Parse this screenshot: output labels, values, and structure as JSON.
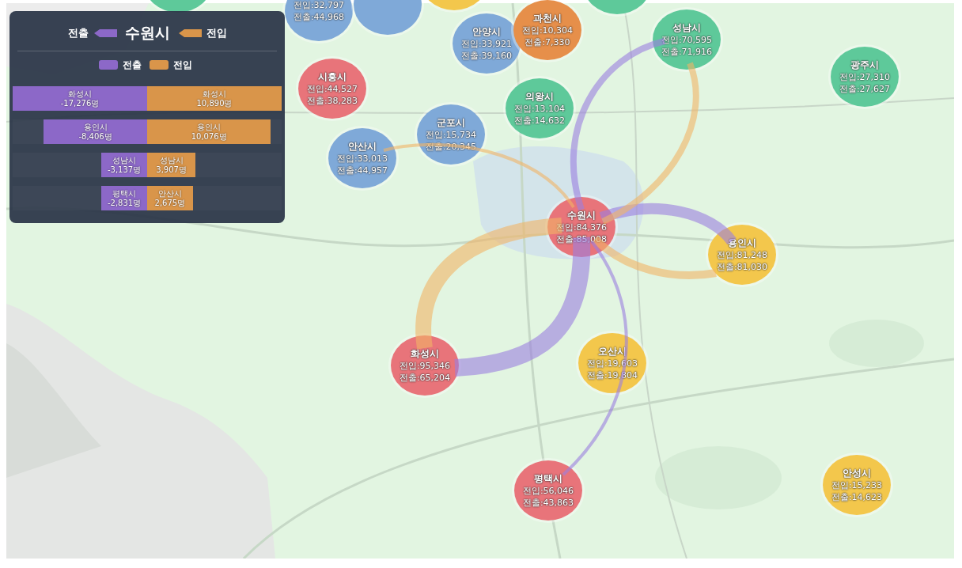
{
  "panel": {
    "out_label": "전출",
    "city": "수원시",
    "in_label": "전입",
    "legend": [
      {
        "label": "전출",
        "color": "#8c68c8"
      },
      {
        "label": "전입",
        "color": "#d9954a"
      }
    ],
    "rows": [
      {
        "outflow": {
          "city": "화성시",
          "value": "-17,276명",
          "level": 1
        },
        "inflow": {
          "city": "화성시",
          "value": "10,890명",
          "level": 1
        }
      },
      {
        "outflow": {
          "city": "용인시",
          "value": "-8,406명",
          "level": 0.77
        },
        "inflow": {
          "city": "용인시",
          "value": "10,076명",
          "level": 0.92
        }
      },
      {
        "outflow": {
          "city": "성남시",
          "value": "-3,137명",
          "level": 0.34
        },
        "inflow": {
          "city": "성남시",
          "value": "3,907명",
          "level": 0.36
        }
      },
      {
        "outflow": {
          "city": "평택시",
          "value": "-2,831명",
          "level": 0.34
        },
        "inflow": {
          "city": "안산시",
          "value": "2,675명",
          "level": 0.34
        }
      }
    ]
  },
  "bubbles": [
    {
      "color": "#5ec99a"
    },
    {
      "color": "#7fa9d8",
      "lines": [
        "전입:32,797",
        "전출:44,968"
      ]
    },
    {
      "color": "#7fa9d8"
    },
    {
      "color": "#f3c74c"
    },
    {
      "color": "#5ec99a"
    },
    {
      "name": "안양시",
      "color": "#7fa9d8",
      "lines": [
        "전입:33,921",
        "전출:39,160"
      ]
    },
    {
      "name": "과천시",
      "color": "#e68f4a",
      "lines": [
        "전입:10,304",
        "전출:7,330"
      ]
    },
    {
      "name": "성남시",
      "color": "#5ec99a",
      "lines": [
        "전입:70,595",
        "전출:71,916"
      ]
    },
    {
      "name": "광주시",
      "color": "#5ec99a",
      "lines": [
        "전입:27,310",
        "전출:27,627"
      ]
    },
    {
      "name": "시흥시",
      "color": "#e8747a",
      "lines": [
        "전입:44,527",
        "전출:38,283"
      ]
    },
    {
      "name": "의왕시",
      "color": "#5ec99a",
      "lines": [
        "전입:13,104",
        "전출:14,632"
      ]
    },
    {
      "name": "군포시",
      "color": "#7fa9d8",
      "lines": [
        "전입:15,734",
        "전출:20,345"
      ]
    },
    {
      "name": "안산시",
      "color": "#7fa9d8",
      "lines": [
        "전입:33,013",
        "전출:44,957"
      ]
    },
    {
      "name": "수원시",
      "color": "#e8747a",
      "lines": [
        "전입:84,376",
        "전출:85,008"
      ]
    },
    {
      "name": "용인시",
      "color": "#f3c74c",
      "lines": [
        "전입:81,248",
        "전출:81,030"
      ]
    },
    {
      "name": "화성시",
      "color": "#e8747a",
      "lines": [
        "전입:95,346",
        "전출:65,204"
      ]
    },
    {
      "name": "오산시",
      "color": "#f3c74c",
      "lines": [
        "전입:19,603",
        "전출:19,804"
      ]
    },
    {
      "name": "평택시",
      "color": "#e8747a",
      "lines": [
        "전입:56,046",
        "전출:43,863"
      ]
    },
    {
      "name": "안성시",
      "color": "#f3c74c",
      "lines": [
        "전입:15,233",
        "전출:14,623"
      ]
    }
  ]
}
